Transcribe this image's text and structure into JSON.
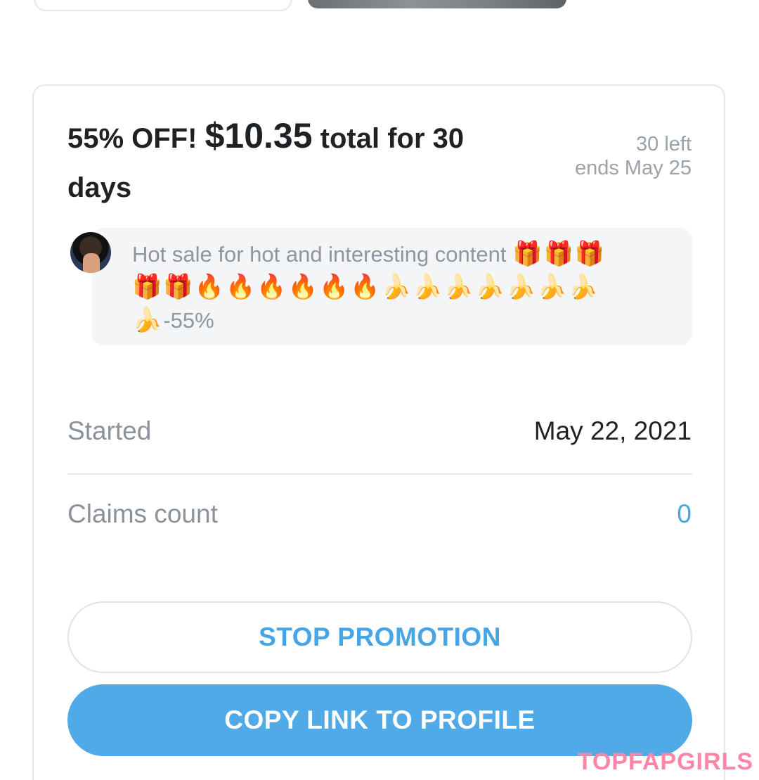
{
  "offer": {
    "headline_prefix": "55% OFF! ",
    "price": "$10.35",
    "headline_suffix": " total for 30 days",
    "remaining": "30 left",
    "ends": "ends May 25"
  },
  "message": {
    "text": "Hot sale for hot and interesting content",
    "emojis_line1": "🎁🎁🎁",
    "emojis_line2": "🎁🎁🔥🔥🔥🔥🔥🔥🍌🍌🍌🍌🍌🍌🍌",
    "emojis_line3": "🍌",
    "discount": "-55%"
  },
  "details": {
    "started_label": "Started",
    "started_value": "May 22, 2021",
    "claims_label": "Claims count",
    "claims_value": "0"
  },
  "buttons": {
    "stop": "STOP PROMOTION",
    "copy": "COPY LINK TO PROFILE"
  },
  "watermark": "TOPFAPGIRLS",
  "colors": {
    "accent": "#50aae7",
    "link_text": "#46a5e5",
    "muted": "#8a929c"
  }
}
